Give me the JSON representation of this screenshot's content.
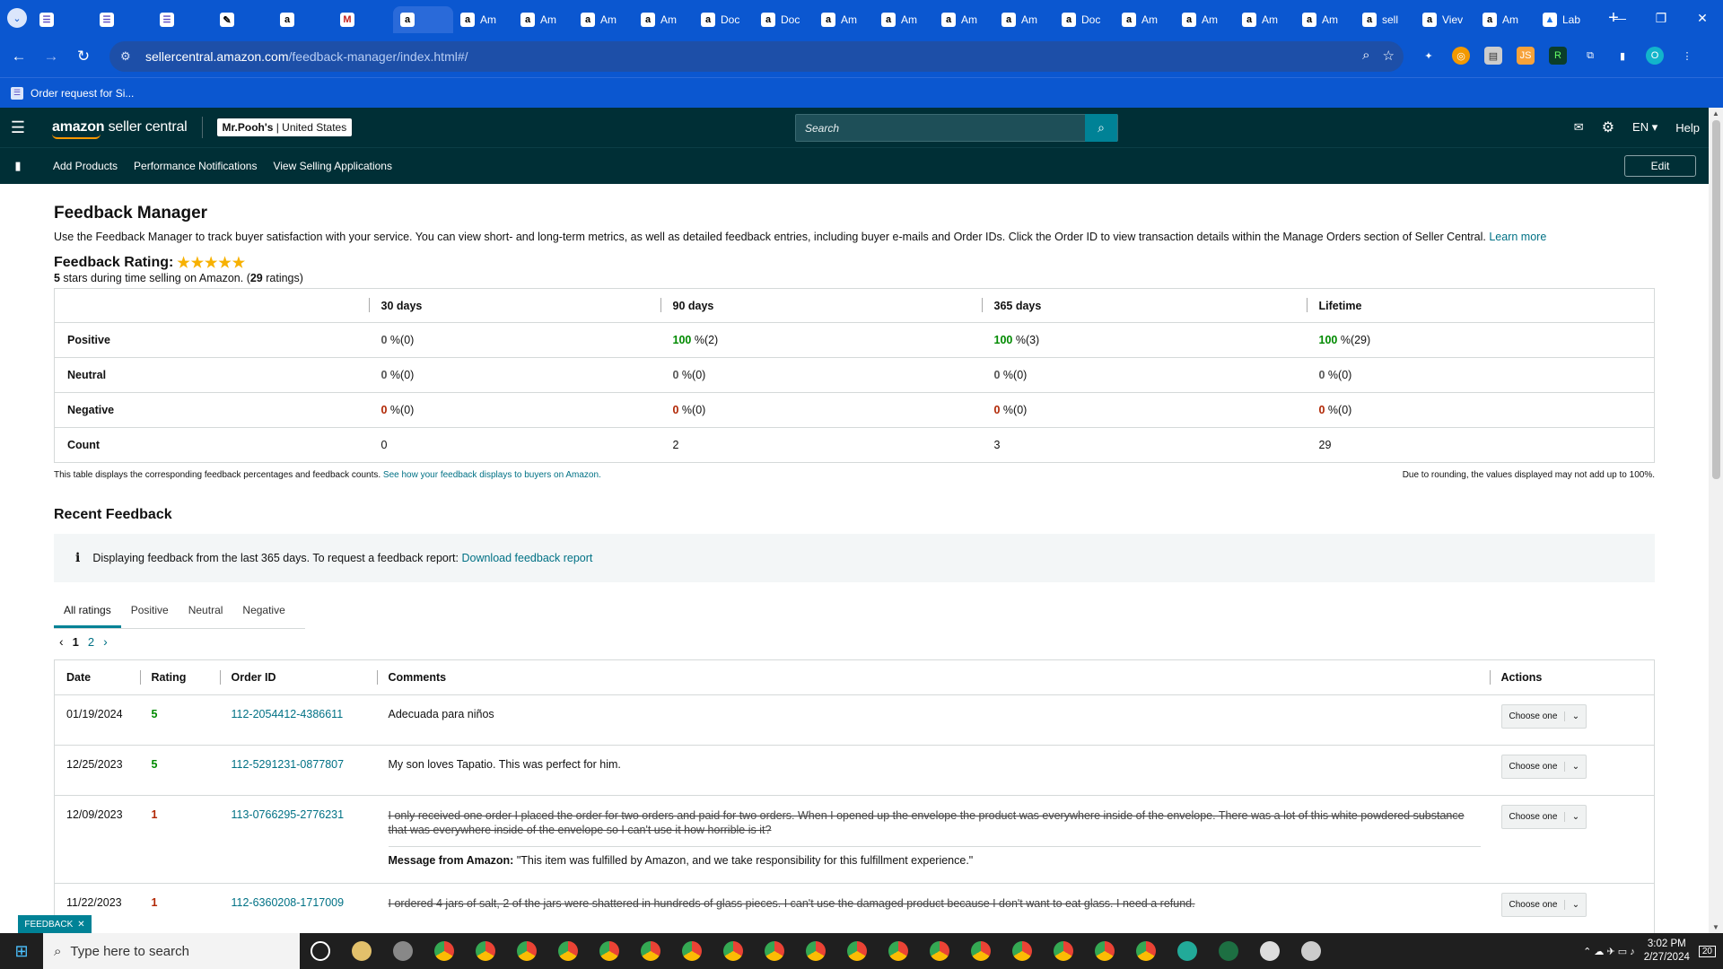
{
  "browser": {
    "tabs": [
      {
        "title": "",
        "icon": "sheet"
      },
      {
        "title": "",
        "icon": "sheet"
      },
      {
        "title": "",
        "icon": "sheet"
      },
      {
        "title": "",
        "icon": "ext"
      },
      {
        "title": "",
        "icon": "amazon"
      },
      {
        "title": "",
        "icon": "gmail"
      },
      {
        "title": "",
        "icon": "amazon",
        "active": true
      },
      {
        "title": "Am",
        "icon": "amazon"
      },
      {
        "title": "Am",
        "icon": "amazon"
      },
      {
        "title": "Am",
        "icon": "amazon"
      },
      {
        "title": "Am",
        "icon": "amazon"
      },
      {
        "title": "Doc",
        "icon": "amazon"
      },
      {
        "title": "Doc",
        "icon": "amazon"
      },
      {
        "title": "Am",
        "icon": "amazon"
      },
      {
        "title": "Am",
        "icon": "amazon"
      },
      {
        "title": "Am",
        "icon": "amazon"
      },
      {
        "title": "Am",
        "icon": "amazon"
      },
      {
        "title": "Doc",
        "icon": "amazon"
      },
      {
        "title": "Am",
        "icon": "amazon"
      },
      {
        "title": "Am",
        "icon": "amazon"
      },
      {
        "title": "Am",
        "icon": "amazon"
      },
      {
        "title": "Am",
        "icon": "amazon"
      },
      {
        "title": "sell",
        "icon": "amazon"
      },
      {
        "title": "Viev",
        "icon": "amazon"
      },
      {
        "title": "Am",
        "icon": "amazon"
      },
      {
        "title": "Lab",
        "icon": "lab"
      }
    ],
    "url_host": "sellercentral.amazon.com",
    "url_path": "/feedback-manager/index.html#/",
    "bookmark": "Order request for Si..."
  },
  "header": {
    "logo_text": "amazon",
    "logo_suffix": " seller central",
    "store_name": "Mr.Pooh's",
    "store_region": " | United States",
    "search_placeholder": "Search",
    "language": "EN",
    "help": "Help"
  },
  "subnav": {
    "links": [
      "Add Products",
      "Performance Notifications",
      "View Selling Applications"
    ],
    "edit": "Edit"
  },
  "page": {
    "title": "Feedback Manager",
    "description": "Use the Feedback Manager to track buyer satisfaction with your service. You can view short- and long-term metrics, as well as detailed feedback entries, including buyer e-mails and Order IDs. Click the Order ID to view transaction details within the Manage Orders section of Seller Central.",
    "learn_more": "Learn more",
    "rating_heading": "Feedback Rating:",
    "rating_stars": 5,
    "rating_sub_stars": "5",
    "rating_sub_text": " stars during time selling on Amazon. (",
    "rating_count": "29",
    "rating_count_suffix": " ratings)"
  },
  "metrics": {
    "columns": [
      "30 days",
      "90 days",
      "365 days",
      "Lifetime"
    ],
    "rows": [
      {
        "label": "Positive",
        "cells": [
          [
            "0",
            " %(0)"
          ],
          [
            "100",
            " %(2)"
          ],
          [
            "100",
            " %(3)"
          ],
          [
            "100",
            " %(29)"
          ]
        ]
      },
      {
        "label": "Neutral",
        "cells": [
          [
            "0",
            " %(0)"
          ],
          [
            "0",
            " %(0)"
          ],
          [
            "0",
            " %(0)"
          ],
          [
            "0",
            " %(0)"
          ]
        ]
      },
      {
        "label": "Negative",
        "cells": [
          [
            "0",
            " %(0)"
          ],
          [
            "0",
            " %(0)"
          ],
          [
            "0",
            " %(0)"
          ],
          [
            "0",
            " %(0)"
          ]
        ]
      },
      {
        "label": "Count",
        "cells": [
          [
            "0",
            ""
          ],
          [
            "2",
            ""
          ],
          [
            "3",
            ""
          ],
          [
            "29",
            ""
          ]
        ]
      }
    ],
    "note_left": "This table displays the corresponding feedback percentages and feedback counts.",
    "note_link": "See how your feedback displays to buyers on Amazon.",
    "note_right": "Due to rounding, the values displayed may not add up to 100%."
  },
  "recent": {
    "title": "Recent Feedback",
    "info_text": "Displaying feedback from the last 365 days. To request a feedback report:",
    "info_link": "Download feedback report",
    "tabs": [
      "All ratings",
      "Positive",
      "Neutral",
      "Negative"
    ],
    "pages": [
      "1",
      "2"
    ],
    "columns": [
      "Date",
      "Rating",
      "Order ID",
      "Comments",
      "Actions"
    ],
    "rows": [
      {
        "date": "01/19/2024",
        "rating": "5",
        "order_id": "112-2054412-4386611",
        "comment": "Adecuada para niños",
        "struck": false,
        "amazon_msg": ""
      },
      {
        "date": "12/25/2023",
        "rating": "5",
        "order_id": "112-5291231-0877807",
        "comment": "My son loves Tapatio. This was perfect for him.",
        "struck": false,
        "amazon_msg": ""
      },
      {
        "date": "12/09/2023",
        "rating": "1",
        "order_id": "113-0766295-2776231",
        "comment": "I only received one order I placed the order for two orders and paid for two orders. When I opened up the envelope the product was everywhere inside of the envelope. There was a lot of this white powdered substance that was everywhere inside of the envelope so I can't use it how horrible is it?",
        "struck": true,
        "amazon_msg": "\"This item was fulfilled by Amazon, and we take responsibility for this fulfillment experience.\""
      },
      {
        "date": "11/22/2023",
        "rating": "1",
        "order_id": "112-6360208-1717009",
        "comment": "I ordered 4 jars of salt, 2 of the jars were shattered in hundreds of glass pieces. I can't use the damaged product because I don't want to eat glass. I need a refund.",
        "struck": true,
        "amazon_msg": ""
      }
    ],
    "amazon_msg_label": "Message from Amazon:",
    "action_label": "Choose one"
  },
  "feedback_tab": "FEEDBACK",
  "taskbar": {
    "search_placeholder": "Type here to search",
    "time": "3:02 PM",
    "date": "2/27/2024",
    "notifications": "20"
  },
  "colors": {
    "accent": "#008296",
    "header_bg": "#002f36",
    "chrome": "#0b57d0",
    "positive": "#008a00",
    "negative": "#b12704"
  }
}
